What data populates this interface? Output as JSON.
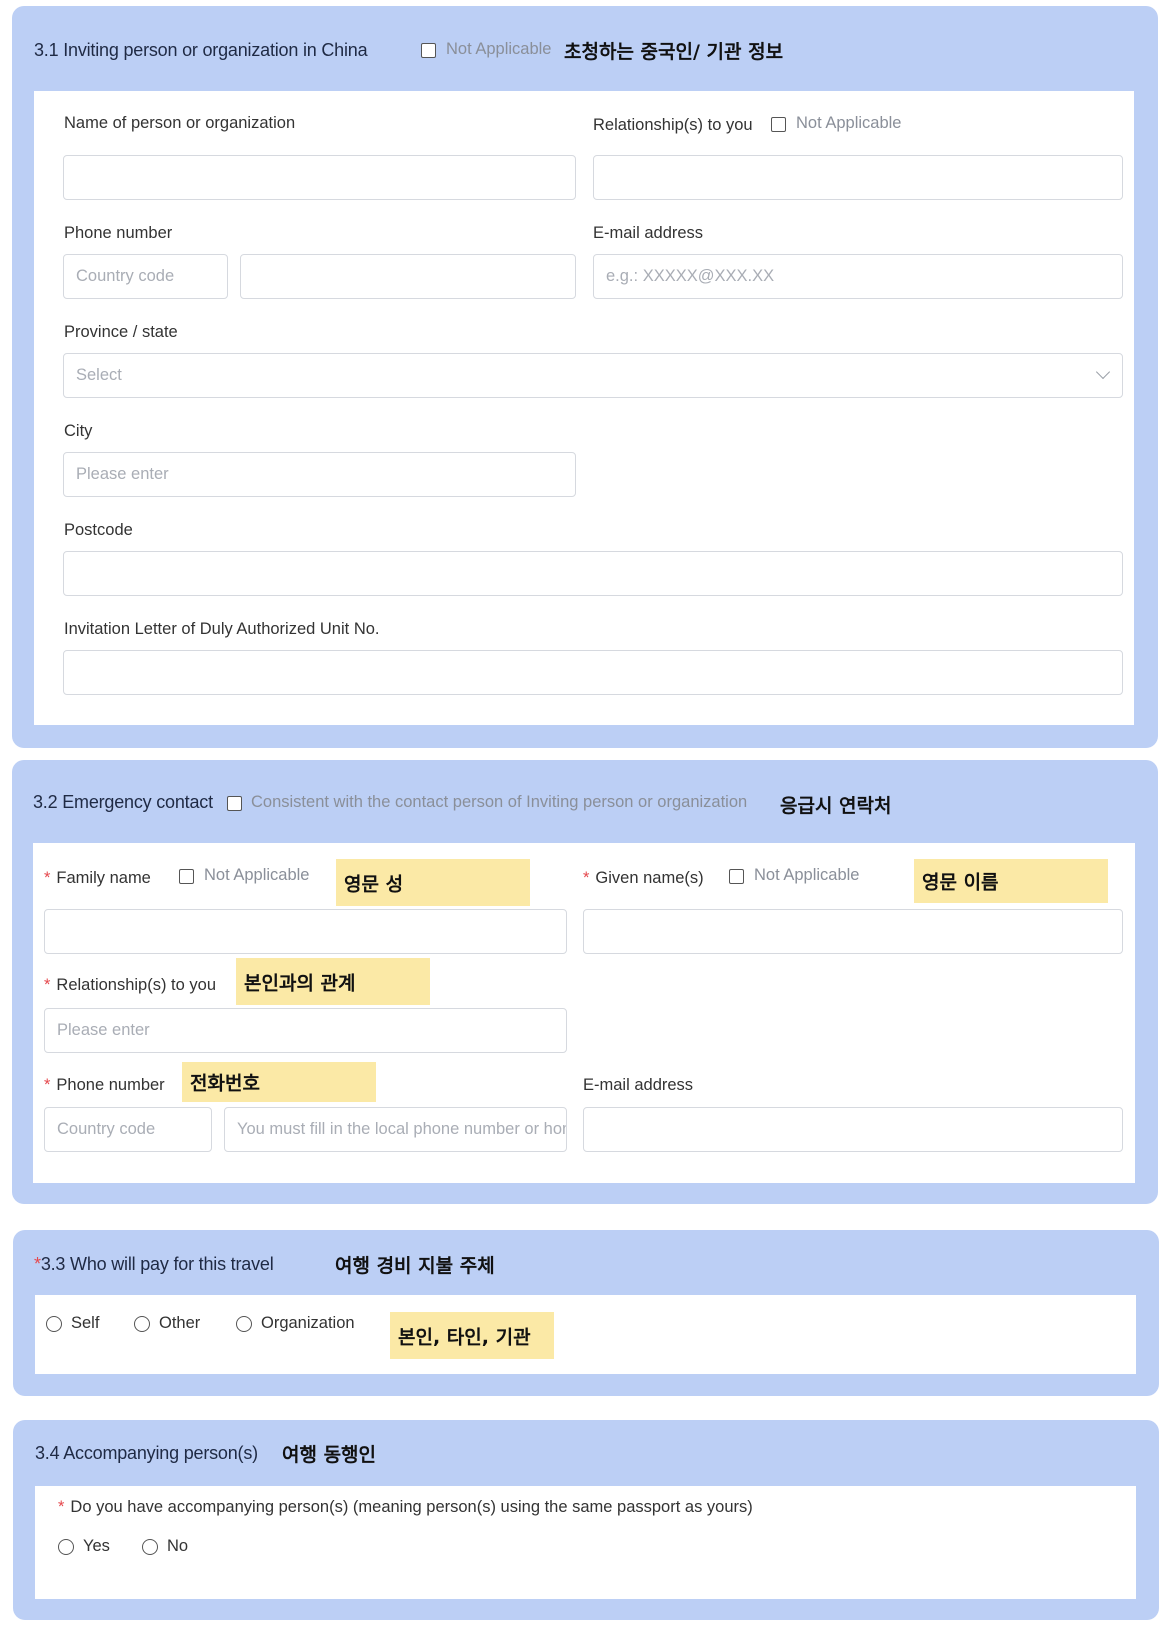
{
  "s31": {
    "title": "3.1 Inviting person or organization in China",
    "na_label": "Not Applicable",
    "kor": "초청하는 중국인/ 기관 정보",
    "name_label": "Name of person or organization",
    "rel_label": "Relationship(s) to you",
    "rel_na": "Not Applicable",
    "phone_label": "Phone number",
    "country_code_ph": "Country code",
    "email_label": "E-mail address",
    "email_ph": "e.g.:  XXXXX@XXX.XX",
    "province_label": "Province / state",
    "province_ph": "Select",
    "city_label": "City",
    "city_ph": "Please enter",
    "postcode_label": "Postcode",
    "invitation_label": "Invitation Letter of Duly Authorized Unit No."
  },
  "s32": {
    "title": "3.2 Emergency contact",
    "consistent_label": "Consistent with the contact person of Inviting person or organization",
    "kor": "응급시 연락처",
    "required_mark": "*",
    "family_label": "Family name",
    "family_na": "Not Applicable",
    "family_kor": "영문 성",
    "given_label": "Given name(s)",
    "given_na": "Not Applicable",
    "given_kor": "영문 이름",
    "rel_label": "Relationship(s) to you",
    "rel_kor": "본인과의 관계",
    "rel_ph": "Please enter",
    "phone_label": "Phone number",
    "phone_kor": "전화번호",
    "country_code_ph": "Country code",
    "phone_ph": "You must fill in the local phone number or home",
    "email_label": "E-mail address"
  },
  "s33": {
    "required_mark": "*",
    "title": "3.3 Who will pay for this travel",
    "kor": "여행 경비 지불 주체",
    "options": [
      "Self",
      "Other",
      "Organization"
    ],
    "options_kor": "본인, 타인, 기관"
  },
  "s34": {
    "title": "3.4 Accompanying person(s)",
    "kor": "여행 동행인",
    "required_mark": "*",
    "question": "Do you have accompanying person(s) (meaning person(s) using the same passport as yours)",
    "options": [
      "Yes",
      "No"
    ]
  }
}
